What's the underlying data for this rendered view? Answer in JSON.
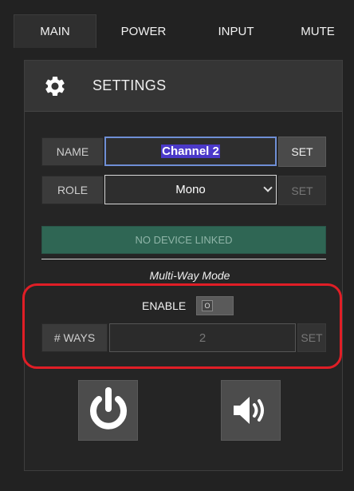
{
  "tabs": [
    {
      "label": "MAIN",
      "active": true
    },
    {
      "label": "POWER",
      "active": false
    },
    {
      "label": "INPUT",
      "active": false
    },
    {
      "label": "MUTE",
      "active": false
    }
  ],
  "panel": {
    "title": "SETTINGS",
    "icon": "gear-icon"
  },
  "name_row": {
    "label": "NAME",
    "value": "Channel 2",
    "set_label": "SET"
  },
  "role_row": {
    "label": "ROLE",
    "selected": "Mono",
    "set_label": "SET"
  },
  "device_status": "NO DEVICE LINKED",
  "multiway": {
    "title": "Multi-Way Mode",
    "enable_label": "ENABLE",
    "toggle_text": "O",
    "ways_label": "# WAYS",
    "ways_value": "2",
    "set_label": "SET"
  },
  "colors": {
    "highlight": "#e01e26",
    "device_bar": "#2f6654",
    "name_focus": "#6f8fd6"
  },
  "buttons": {
    "power_icon": "power-icon",
    "volume_icon": "volume-icon"
  }
}
